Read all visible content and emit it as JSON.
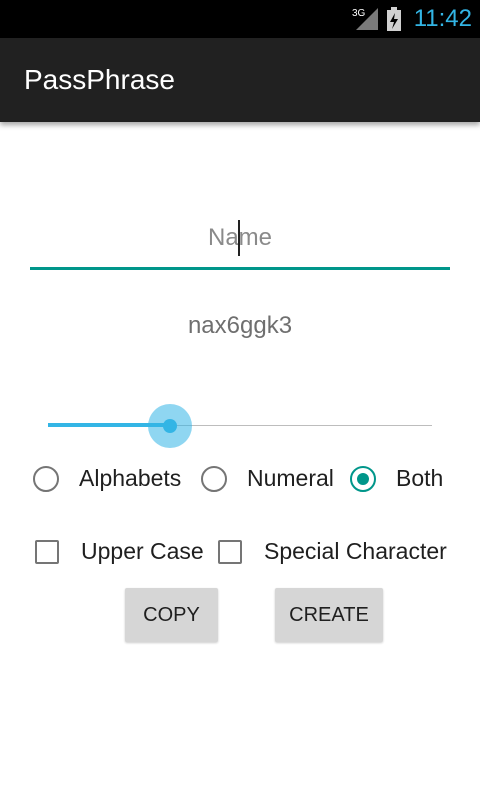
{
  "status_bar": {
    "network": "3G",
    "time": "11:42"
  },
  "app": {
    "title": "PassPhrase"
  },
  "name_field": {
    "placeholder": "Name",
    "value": ""
  },
  "generated_password": "nax6ggk3",
  "length_slider": {
    "fraction": 0.317
  },
  "type_options": [
    {
      "label": "Alphabets",
      "checked": false
    },
    {
      "label": "Numeral",
      "checked": false
    },
    {
      "label": "Both",
      "checked": true
    }
  ],
  "checkboxes": [
    {
      "label": "Upper Case",
      "checked": false
    },
    {
      "label": "Special Character",
      "checked": false
    }
  ],
  "buttons": {
    "copy": "COPY",
    "create": "CREATE"
  },
  "colors": {
    "accent": "#00968a",
    "slider": "#33b5e5",
    "action_bar": "#212121"
  }
}
